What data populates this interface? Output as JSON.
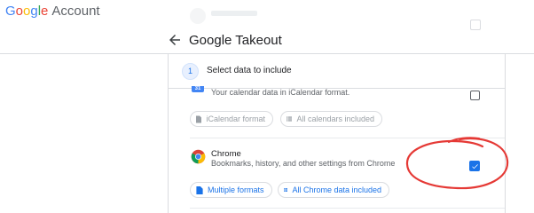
{
  "app": {
    "brand_google": [
      "G",
      "o",
      "o",
      "g",
      "l",
      "e"
    ],
    "brand_account": "Account"
  },
  "header": {
    "title": "Google Takeout",
    "back_icon": "arrow-back-icon"
  },
  "step": {
    "number": "1",
    "title": "Select data to include"
  },
  "products": [
    {
      "name": "Calendar",
      "description": "Your calendar data in iCalendar format.",
      "icon": "calendar-icon",
      "icon_badge": "31",
      "selected": false,
      "chips": [
        {
          "label": "iCalendar format",
          "icon": "file-icon",
          "enabled": false
        },
        {
          "label": "All calendars included",
          "icon": "list-icon",
          "enabled": false
        }
      ]
    },
    {
      "name": "Chrome",
      "description": "Bookmarks, history, and other settings from Chrome",
      "icon": "chrome-icon",
      "selected": true,
      "chips": [
        {
          "label": "Multiple formats",
          "icon": "file-icon",
          "enabled": true
        },
        {
          "label": "All Chrome data included",
          "icon": "list-icon",
          "enabled": true
        }
      ]
    }
  ],
  "colors": {
    "accent": "#1a73e8",
    "annotation": "#e53935",
    "border": "#dadce0",
    "text_secondary": "#5f6368",
    "disabled": "#9aa0a6"
  }
}
